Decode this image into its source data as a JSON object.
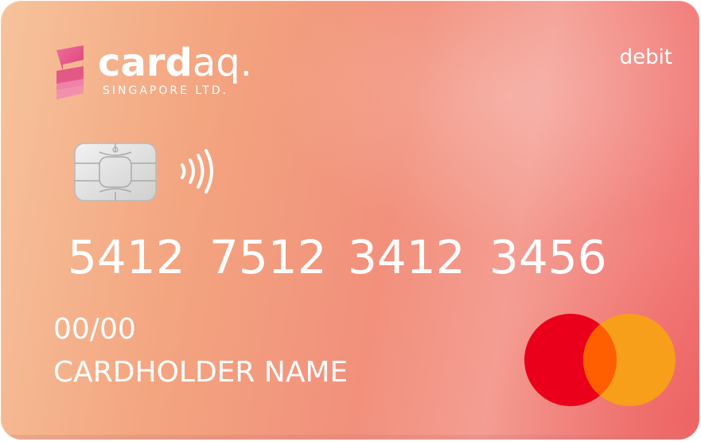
{
  "brand": {
    "name_bold": "card",
    "name_light": "aq.",
    "subtitle": "SINGAPORE LTD."
  },
  "card": {
    "type": "debit",
    "number_groups": [
      "5412",
      "7512",
      "3412",
      "3456"
    ],
    "expiry": "00/00",
    "holder_name": "CARDHOLDER NAME",
    "network_icon": "mastercard-logo-icon",
    "chip_icon": "emv-chip-icon",
    "contactless_icon": "contactless-icon"
  },
  "colors": {
    "mastercard_red": "#eb001b",
    "mastercard_orange": "#f79e1b",
    "mastercard_overlap": "#ff5f00",
    "logo_pink": "#e8457f"
  }
}
